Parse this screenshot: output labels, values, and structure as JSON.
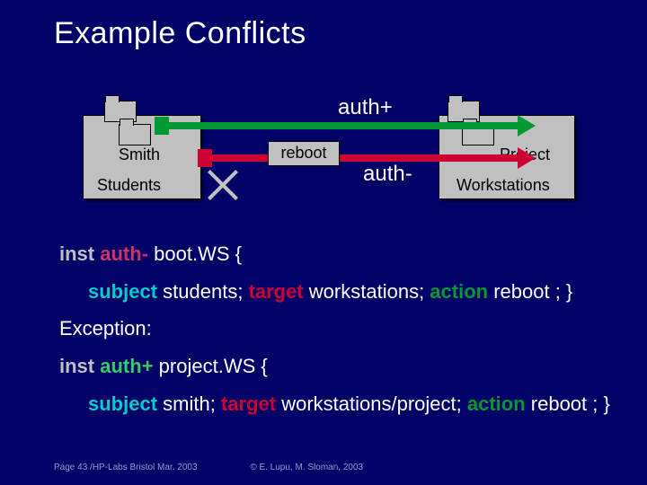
{
  "title": "Example Conflicts",
  "diagram": {
    "smith": "Smith",
    "project": "Project",
    "students": "Students",
    "workstations": "Workstations",
    "reboot": "reboot",
    "auth_plus": "auth+",
    "auth_minus": "auth-"
  },
  "policy1": {
    "inst": "inst",
    "auth": "auth-",
    "name": " boot.WS {",
    "subject_kw": "subject",
    "subject_val": " students; ",
    "target_kw": "target",
    "target_val": " workstations; ",
    "action_kw": "action",
    "action_val": " reboot ; }"
  },
  "exception_label": "Exception:",
  "policy2": {
    "inst": "inst",
    "auth": "auth+",
    "name": " project.WS {",
    "subject_kw": "subject",
    "subject_val": " smith; ",
    "target_kw": "target",
    "target_val": " workstations/project; ",
    "action_kw": "action",
    "action_val": " reboot ; }"
  },
  "footer": {
    "left": "Page 43 /HP-Labs Bristol Mar. 2003",
    "right": "© E. Lupu, M. Sloman, 2003"
  }
}
